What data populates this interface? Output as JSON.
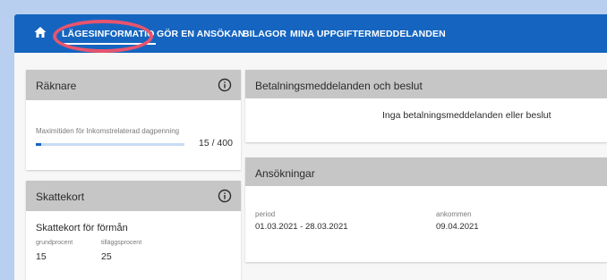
{
  "nav": {
    "items": [
      {
        "label": "LÄGESINFORMATIO",
        "active": true
      },
      {
        "label": "GÖR EN ANSÖKAN"
      },
      {
        "label": "BILAGOR"
      },
      {
        "label": "MINA UPPGIFTER"
      },
      {
        "label": "MEDDELANDEN"
      }
    ]
  },
  "raknare": {
    "title": "Räknare",
    "label": "Maximitiden för Inkomstrelaterad dagpenning",
    "counter": "15 / 400",
    "progress": 0.0375
  },
  "skattekort": {
    "title": "Skattekort",
    "subtitle": "Skattekort för förmån",
    "col1_label": "grundprocent",
    "col1_value": "15",
    "col2_label": "tilläggsprocent",
    "col2_value": "25"
  },
  "betalning": {
    "title": "Betalningsmeddelanden och beslut",
    "empty_text": "Inga betalningsmeddelanden eller beslut"
  },
  "ansokningar": {
    "title": "Ansökningar",
    "period_label": "period",
    "period_value": "01.03.2021 - 28.03.2021",
    "ankommen_label": "ankommen",
    "ankommen_value": "09.04.2021"
  },
  "colors": {
    "navbar": "#1565c0",
    "card_header": "#c6c6c6",
    "highlight": "#e8546d",
    "progress_track": "#c7dcf6"
  }
}
